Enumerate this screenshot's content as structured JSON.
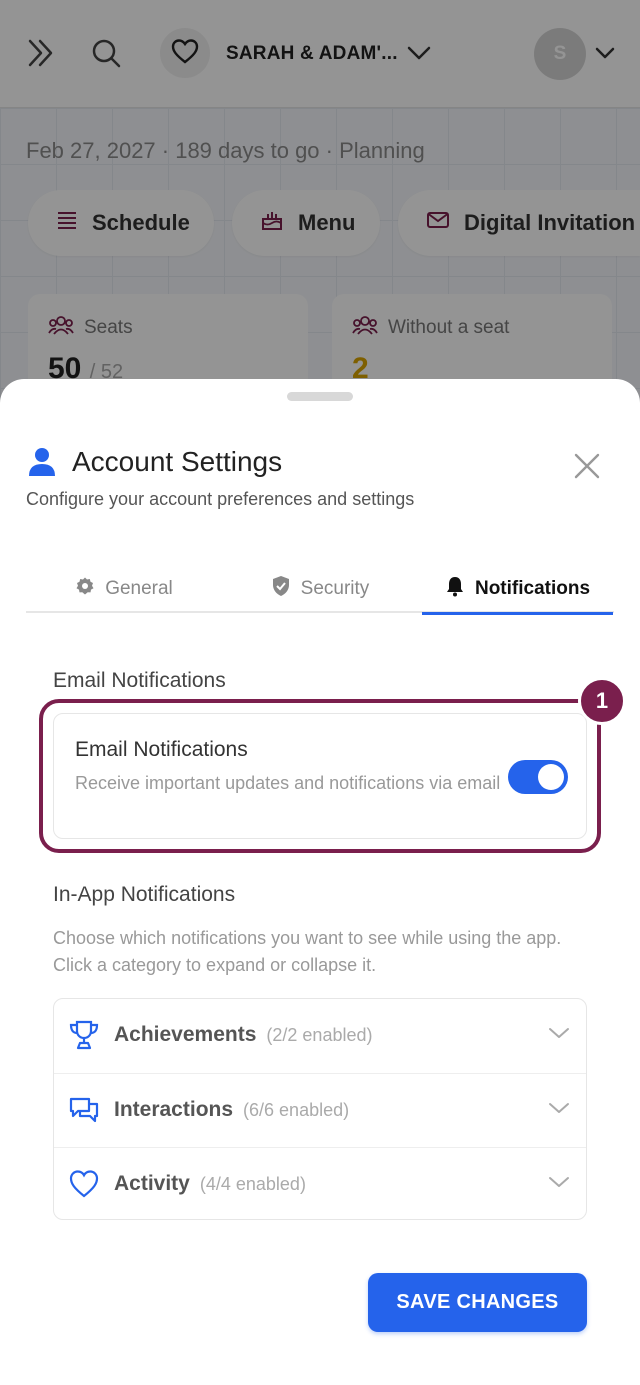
{
  "topbar": {
    "event_name": "SARAH & ADAM'...",
    "avatar_initial": "S"
  },
  "background": {
    "meta_line": "Feb 27, 2027 · 189 days to go · Planning",
    "pills": [
      "Schedule",
      "Menu",
      "Digital Invitation"
    ],
    "stats": [
      {
        "label": "Seats",
        "value": "50",
        "total": "/ 52"
      },
      {
        "label": "Without a seat",
        "value": "2"
      }
    ]
  },
  "sheet": {
    "title": "Account Settings",
    "subtitle": "Configure your account preferences and settings",
    "tabs": [
      {
        "label": "General",
        "icon": "gear-icon",
        "active": false
      },
      {
        "label": "Security",
        "icon": "shield-icon",
        "active": false
      },
      {
        "label": "Notifications",
        "icon": "bell-icon",
        "active": true
      }
    ],
    "email_section": {
      "heading": "Email Notifications",
      "card_title": "Email Notifications",
      "card_description": "Receive important updates and notifications via email",
      "enabled": true
    },
    "highlight_badge": "1",
    "inapp_section": {
      "heading": "In-App Notifications",
      "description": "Choose which notifications you want to see while using the app. Click a category to expand or collapse it.",
      "categories": [
        {
          "name": "Achievements",
          "count": "(2/2 enabled)",
          "icon": "trophy-icon"
        },
        {
          "name": "Interactions",
          "count": "(6/6 enabled)",
          "icon": "chat-icon"
        },
        {
          "name": "Activity",
          "count": "(4/4 enabled)",
          "icon": "heart-icon"
        }
      ]
    },
    "save_label": "SAVE CHANGES"
  },
  "colors": {
    "accent": "#2563eb",
    "highlight": "#7a1f4d"
  }
}
